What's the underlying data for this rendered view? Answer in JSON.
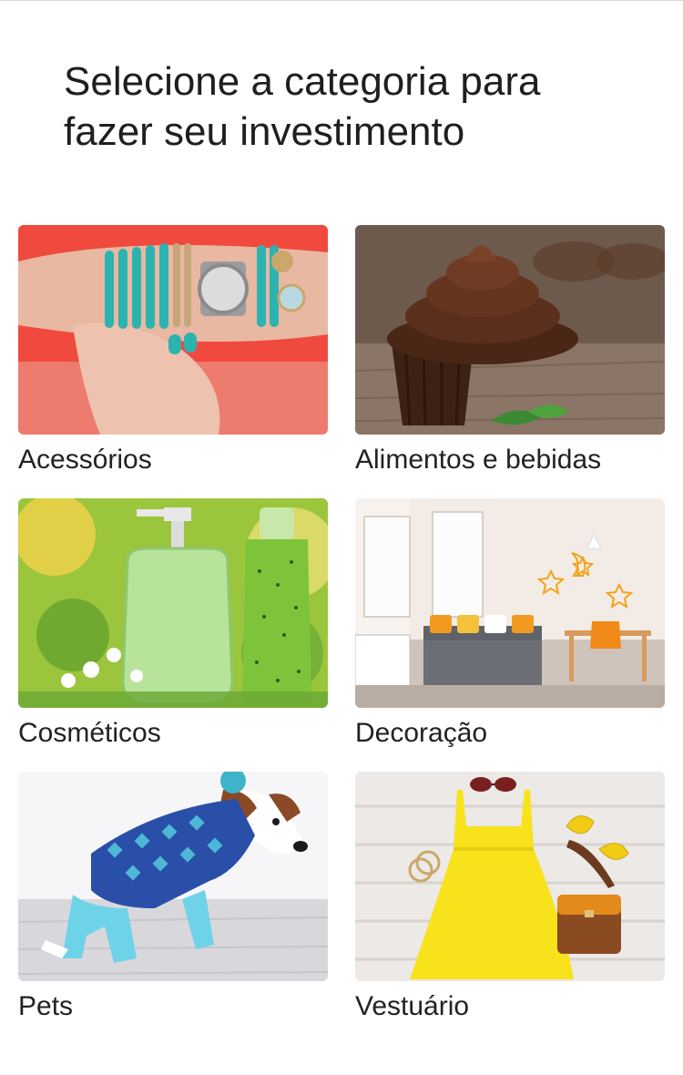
{
  "header": {
    "title_line1": "Selecione a categoria para",
    "title_line2": "fazer seu investimento"
  },
  "categories": [
    {
      "label": "Acessórios",
      "image": "bracelets-watch-photo"
    },
    {
      "label": "Alimentos e bebidas",
      "image": "chocolate-cupcake-photo"
    },
    {
      "label": "Cosméticos",
      "image": "cosmetic-bottles-photo"
    },
    {
      "label": "Decoração",
      "image": "living-room-photo"
    },
    {
      "label": "Pets",
      "image": "dog-in-sweater-photo"
    },
    {
      "label": "Vestuário",
      "image": "yellow-dress-photo"
    }
  ],
  "colors": {
    "background": "#ffffff",
    "text": "#222222",
    "divider": "#d7d7d7"
  }
}
